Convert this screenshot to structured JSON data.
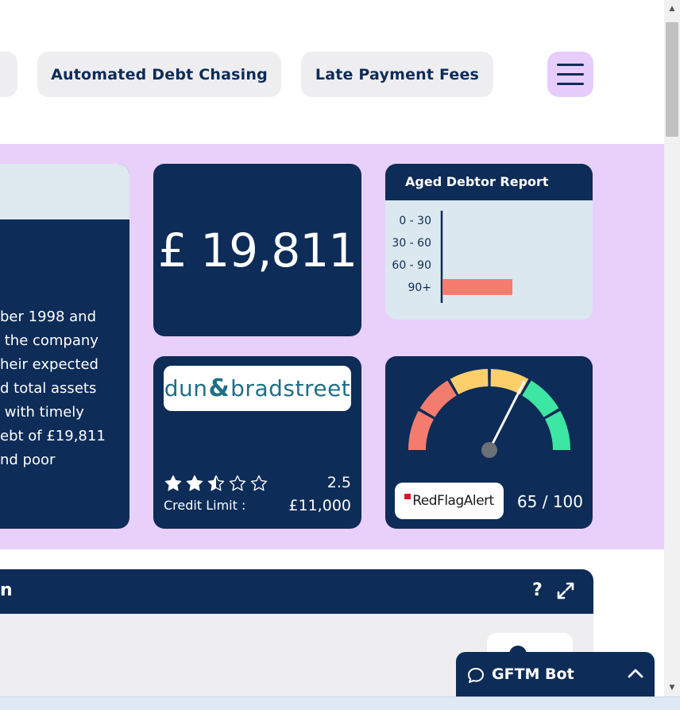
{
  "nav": {
    "items": [
      {
        "label": ""
      },
      {
        "label": "Automated Debt Chasing"
      },
      {
        "label": "Late Payment Fees"
      }
    ]
  },
  "company": {
    "description": "ber 1998 and\n the company\nheir expected\nd total assets\n with timely\nebt of £19,811\nnd poor"
  },
  "debt": {
    "amount": "£ 19,811"
  },
  "aged_debtor": {
    "title": "Aged Debtor Report",
    "chart_data": {
      "type": "bar",
      "orientation": "horizontal",
      "categories": [
        "0 - 30",
        "30 - 60",
        "60 - 90",
        "90+"
      ],
      "values": [
        0,
        0,
        0,
        19811
      ],
      "bar_color": "#f47c6e",
      "grid": false
    }
  },
  "dnb": {
    "logo_left": "dun",
    "logo_amp": "&",
    "logo_right": "bradstreet",
    "rating": "2.5",
    "rating_stars": 2.5,
    "credit_label": "Credit Limit :",
    "credit_value": "£11,000"
  },
  "rfa": {
    "logo": "RedFlagAlert",
    "score_text": "65 / 100",
    "score": 65,
    "segment_colors": [
      "#f47c6e",
      "#f47c6e",
      "#fccf6a",
      "#fccf6a",
      "#3ee6a3",
      "#3ee6a3"
    ]
  },
  "panel": {
    "title": "n",
    "help": "?"
  },
  "bot": {
    "label": "GFTM Bot"
  },
  "colors": {
    "navy": "#0d2c57",
    "lavender": "#e8d0fb",
    "accent_red": "#f47c6e"
  }
}
